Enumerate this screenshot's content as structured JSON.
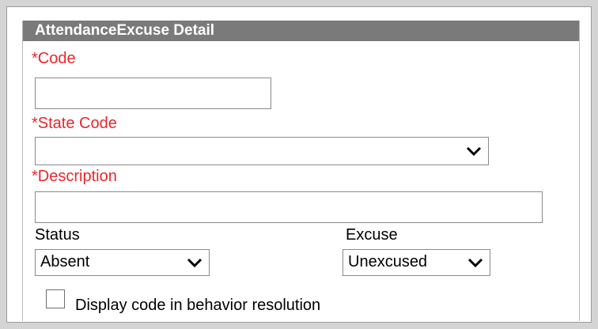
{
  "section": {
    "title": "AttendanceExcuse Detail"
  },
  "code": {
    "label": "*Code",
    "value": ""
  },
  "state_code": {
    "label": "*State Code",
    "selected": ""
  },
  "description": {
    "label": "*Description",
    "value": ""
  },
  "status": {
    "label": "Status",
    "selected": "Absent"
  },
  "excuse": {
    "label": "Excuse",
    "selected": "Unexcused"
  },
  "behavior_checkbox": {
    "label": "Display code in behavior resolution",
    "checked": false
  },
  "colors": {
    "required_label": "#e8262d",
    "header_bg": "#7a7a7a",
    "header_text": "#ffffff"
  },
  "icons": {
    "dropdown": "chevron-down-icon"
  }
}
